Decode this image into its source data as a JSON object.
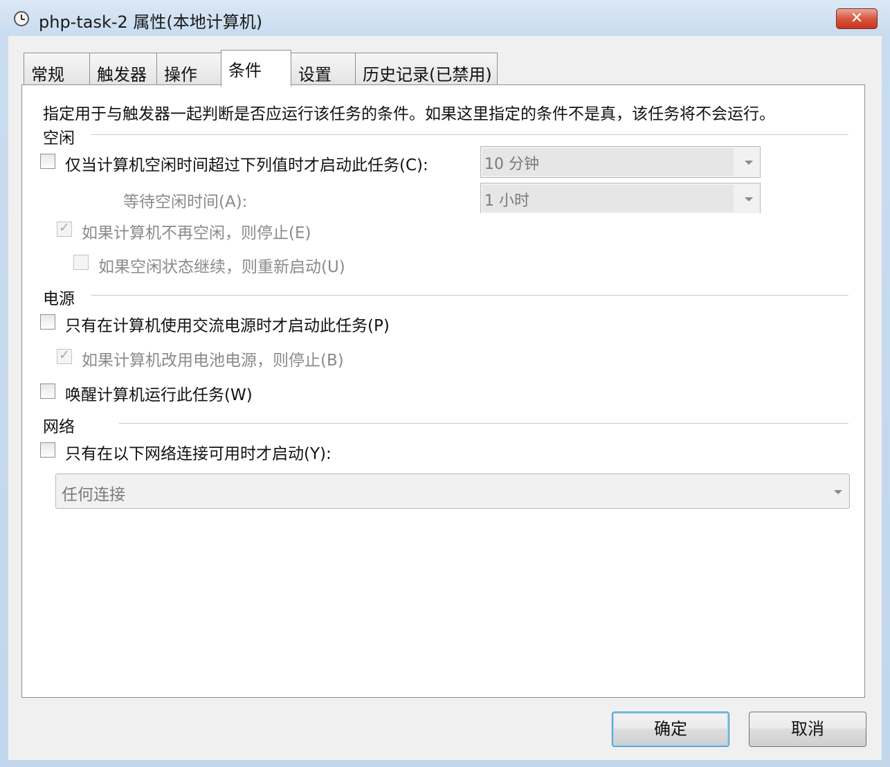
{
  "window": {
    "title": "php-task-2 属性(本地计算机)",
    "close_label": "✕"
  },
  "tabs": [
    {
      "label": "常规",
      "active": false
    },
    {
      "label": "触发器",
      "active": false
    },
    {
      "label": "操作",
      "active": false
    },
    {
      "label": "条件",
      "active": true
    },
    {
      "label": "设置",
      "active": false
    },
    {
      "label": "历史记录(已禁用)",
      "active": false
    }
  ],
  "conditions": {
    "description": "指定用于与触发器一起判断是否应运行该任务的条件。如果这里指定的条件不是真，该任务将不会运行。",
    "idle": {
      "section_label": "空闲",
      "start_only_if_idle": {
        "label": "仅当计算机空闲时间超过下列值时才启动此任务(C):",
        "checked": false
      },
      "idle_duration": {
        "value": "10 分钟"
      },
      "wait_label": "等待空闲时间(A):",
      "wait_duration": {
        "value": "1 小时"
      },
      "stop_if_not_idle": {
        "label": "如果计算机不再空闲，则停止(E)",
        "checked": true,
        "enabled": false
      },
      "restart_if_idle_resumes": {
        "label": "如果空闲状态继续，则重新启动(U)",
        "checked": false,
        "enabled": false
      }
    },
    "power": {
      "section_label": "电源",
      "ac_only": {
        "label": "只有在计算机使用交流电源时才启动此任务(P)",
        "checked": false
      },
      "stop_on_battery": {
        "label": "如果计算机改用电池电源，则停止(B)",
        "checked": true,
        "enabled": false
      },
      "wake_to_run": {
        "label": "唤醒计算机运行此任务(W)",
        "checked": false
      }
    },
    "network": {
      "section_label": "网络",
      "only_if_network": {
        "label": "只有在以下网络连接可用时才启动(Y):",
        "checked": false
      },
      "connection": {
        "value": "任何连接"
      }
    }
  },
  "buttons": {
    "ok_label": "确定",
    "cancel_label": "取消"
  }
}
